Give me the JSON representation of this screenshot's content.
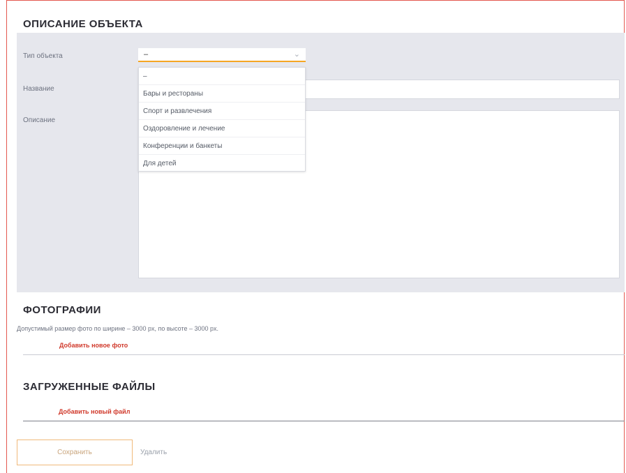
{
  "object_section": {
    "title": "ОПИСАНИЕ ОБЪЕКТА",
    "type_label": "Тип объекта",
    "type_value": "–",
    "name_label": "Название",
    "description_label": "Описание",
    "dropdown_options": [
      "–",
      "Бары и рестораны",
      "Спорт и развлечения",
      "Оздоровление и лечение",
      "Конференции и банкеты",
      "Для детей"
    ]
  },
  "photos_section": {
    "title": "ФОТОГРАФИИ",
    "hint": "Допустимый размер фото по ширине – 3000 px, по высоте – 3000 px.",
    "add_photo_link": "Добавить новое фото"
  },
  "files_section": {
    "title": "ЗАГРУЖЕННЫЕ ФАЙЛЫ",
    "add_file_link": "Добавить новый файл"
  },
  "actions": {
    "save_label": "Сохранить",
    "delete_label": "Удалить"
  },
  "colors": {
    "accent_orange": "#f5a623",
    "link_red": "#d0392b",
    "panel_gray": "#e6e7ed",
    "frame_red": "#e4574e"
  }
}
